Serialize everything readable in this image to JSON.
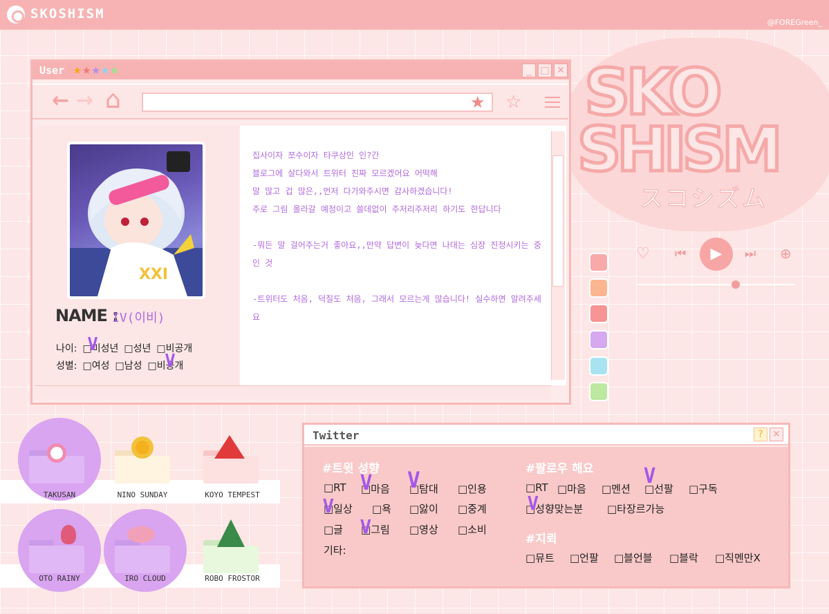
{
  "topbar": {
    "brand": "SKOSHISM",
    "credit": "@FOREGreen_"
  },
  "biglogo": {
    "line1": "SKO",
    "line2": "SHISM",
    "sub": "スコシズム"
  },
  "user_window": {
    "title": "User",
    "stars": [
      "★",
      "★",
      "★",
      "★",
      "★"
    ],
    "star_colors": [
      "#f5a623",
      "#f27a7a",
      "#b48ee8",
      "#8fd1f0",
      "#9be38a"
    ],
    "minimize": "_",
    "maximize": "□",
    "close": "✕"
  },
  "toolbar": {
    "back": "←",
    "forward": "→",
    "home": "⌂",
    "url_star": "★",
    "bookmark": "☆"
  },
  "profile": {
    "name_label": "NAME :",
    "name_value": "IV(이비)",
    "age_label": "나이:",
    "age_options": [
      "□미성년",
      "□성년",
      "□비공개"
    ],
    "gender_label": "성별:",
    "gender_options": [
      "□여성",
      "□남성",
      "□비공개"
    ],
    "check_mark": "V"
  },
  "bio": [
    "집사이자 쪼수이자 타쿠상인 인?간",
    "블로그에 살다와서 트위터 진짜 모르겠어요 어떡해",
    "말 많고 겁 많은,,먼저 다가와주시면 감사하겠습니다!",
    "주로 그림 올라갈 예정이고 쓸데없이 주저리주저리 하기도 한답니다",
    "-뭐든 말 걸어주는거 좋아요,,만약 답변이 늦다면 나대는 심장 진정시키는 중인 것",
    "-트위터도 처음, 덕질도 처음, 그래서 모르는게 많습니다! 실수하면 알려주세요"
  ],
  "swatches": [
    "#f9a9a9",
    "#fbb58f",
    "#f79494",
    "#d6a8f0",
    "#a8e3f2",
    "#bde8a0"
  ],
  "player": {
    "heart": "♡",
    "prev": "⏮",
    "play": "▶",
    "next": "⏭",
    "add": "⊕"
  },
  "folders": [
    {
      "label": "TAKUSAN"
    },
    {
      "label": "NINO SUNDAY"
    },
    {
      "label": "KOYO TEMPEST"
    },
    {
      "label": "OTO RAINY"
    },
    {
      "label": "IRO CLOUD"
    },
    {
      "label": "ROBO FROSTOR"
    }
  ],
  "twitter": {
    "title": "Twitter",
    "help": "?",
    "close": "✕",
    "tweet_title": "#트윗 성향",
    "tweet_rows": [
      [
        "□RT",
        "□마음",
        "□탐대",
        "□인용"
      ],
      [
        "□일상",
        "□욕",
        "□앓이",
        "□중계"
      ],
      [
        "□글",
        "□그림",
        "□영상",
        "□소비"
      ]
    ],
    "etc_label": "기타:",
    "follow_title": "#팔로우 해요",
    "follow_row1": [
      "□RT",
      "□마음",
      "□멘션",
      "□선팔",
      "□구독"
    ],
    "follow_row2": [
      "□성향맞는분",
      "□타장르가능"
    ],
    "block_title": "#지뢰",
    "block_row": [
      "□뮤트",
      "□언팔",
      "□블언블",
      "□블락",
      "□직멘만X"
    ]
  }
}
